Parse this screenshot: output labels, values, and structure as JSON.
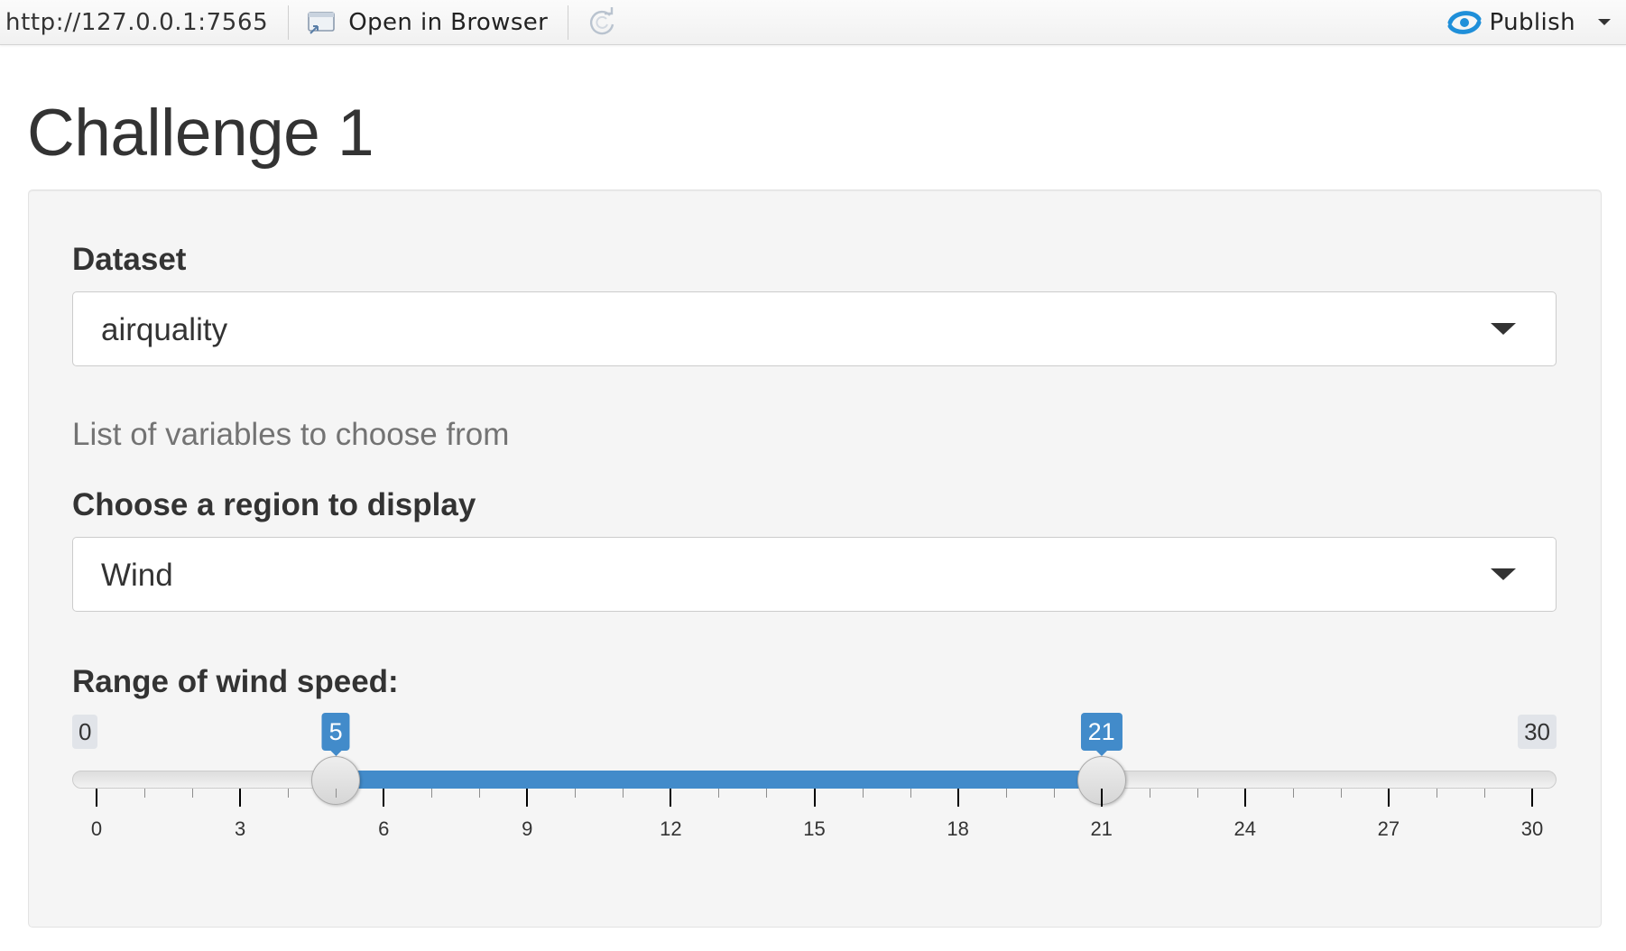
{
  "toolbar": {
    "url": "http://127.0.0.1:7565",
    "open_in_browser_label": "Open in Browser",
    "open_icon": "open-in-browser-icon",
    "refresh_icon": "refresh-icon",
    "publish_label": "Publish",
    "publish_icon": "publish-icon",
    "publish_accent": "#1f8fd9"
  },
  "page": {
    "title": "Challenge 1"
  },
  "sidebar": {
    "dataset_label": "Dataset",
    "dataset_value": "airquality",
    "help_text": "List of variables to choose from",
    "region_label": "Choose a region to display",
    "region_value": "Wind",
    "slider": {
      "label": "Range of wind speed:",
      "min": 0,
      "max": 30,
      "from": 5,
      "to": 21,
      "ticks": [
        "0",
        "3",
        "6",
        "9",
        "12",
        "15",
        "18",
        "21",
        "24",
        "27",
        "30"
      ],
      "min_label": "0",
      "max_label": "30",
      "from_label": "5",
      "to_label": "21",
      "accent": "#428bca"
    }
  }
}
